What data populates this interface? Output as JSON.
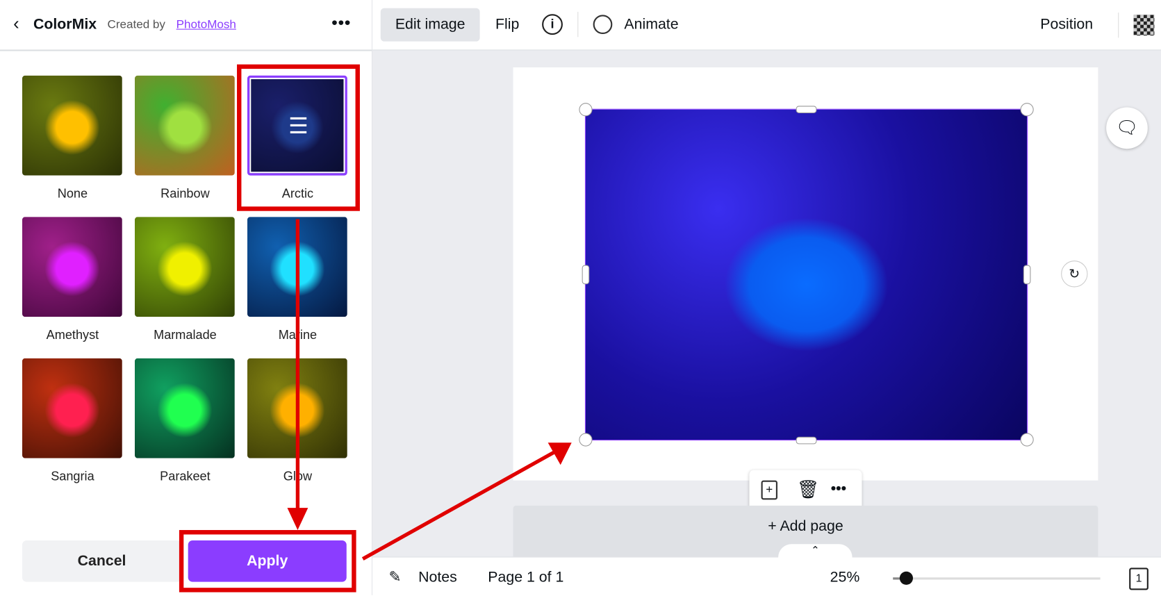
{
  "panel": {
    "back_label": "ColorMix",
    "created_by": "Created by",
    "author": "PhotoMosh",
    "filters": [
      {
        "label": "None",
        "c1": "#6a7a10",
        "c2": "#2a3005",
        "flower": "#ffc000"
      },
      {
        "label": "Rainbow",
        "c1": "#40b030",
        "c2": "#c06020",
        "flower": "#a0e040"
      },
      {
        "label": "Arctic",
        "c1": "#1a1f6a",
        "c2": "#0a0d30",
        "flower": "#1e3a8a"
      },
      {
        "label": "Amethyst",
        "c1": "#a0208a",
        "c2": "#40063a",
        "flower": "#e020ff"
      },
      {
        "label": "Marmalade",
        "c1": "#80b010",
        "c2": "#304005",
        "flower": "#f0f000"
      },
      {
        "label": "Marine",
        "c1": "#1060b0",
        "c2": "#051840",
        "flower": "#20e0ff"
      },
      {
        "label": "Sangria",
        "c1": "#c03010",
        "c2": "#401005",
        "flower": "#ff2050"
      },
      {
        "label": "Parakeet",
        "c1": "#10a060",
        "c2": "#053020",
        "flower": "#20ff50"
      },
      {
        "label": "Glow",
        "c1": "#808010",
        "c2": "#303005",
        "flower": "#ffb000"
      }
    ],
    "selected": "Arctic",
    "cancel_label": "Cancel",
    "apply_label": "Apply"
  },
  "toolbar": {
    "edit_image": "Edit image",
    "flip": "Flip",
    "animate": "Animate",
    "position": "Position"
  },
  "canvas": {
    "add_page": "+ Add page"
  },
  "footer": {
    "notes": "Notes",
    "page": "Page 1 of 1",
    "zoom": "25%",
    "zoom_value": 25,
    "page_count": "1"
  },
  "colors": {
    "accent": "#7d2ae8",
    "annotation": "#e00000",
    "image_bg": "#1a10c0"
  }
}
